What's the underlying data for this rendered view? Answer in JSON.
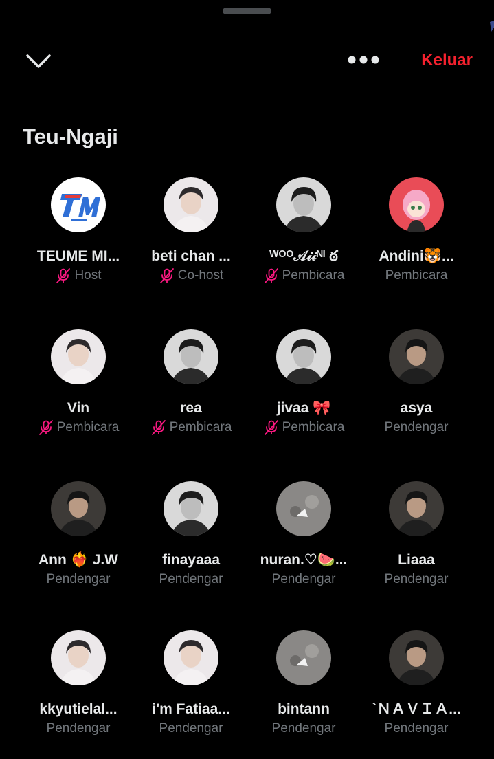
{
  "topbar": {
    "collapse_icon": "chevron-down-icon",
    "more_icon": "more-horizontal-icon",
    "leave_label": "Keluar",
    "leave_color": "#f4212e"
  },
  "space": {
    "title": "Teu-Ngaji"
  },
  "colors": {
    "background": "#000000",
    "text_primary": "#e7e9ea",
    "text_secondary": "#71767b",
    "muted_mic": "#f91880"
  },
  "participants": [
    {
      "name": "TEUME MI...",
      "role": "Host",
      "muted": true,
      "avatar": "logo-tm"
    },
    {
      "name": "beti chan ...",
      "role": "Co-host",
      "muted": true,
      "avatar": "photo-light"
    },
    {
      "name": "ᵂᴼᴼ𝒜𝒾𝒾ᴺᴵ ఠ",
      "role": "Pembicara",
      "muted": true,
      "avatar": "photo-bw"
    },
    {
      "name": "Andini🐯...",
      "role": "Pembicara",
      "muted": false,
      "avatar": "anime-pink"
    },
    {
      "name": "Vin",
      "role": "Pembicara",
      "muted": true,
      "avatar": "photo-light"
    },
    {
      "name": "rea",
      "role": "Pembicara",
      "muted": true,
      "avatar": "photo-bw"
    },
    {
      "name": "jivaa 🎀",
      "role": "Pembicara",
      "muted": true,
      "avatar": "photo-bw"
    },
    {
      "name": "asya",
      "role": "Pendengar",
      "muted": false,
      "avatar": "photo-dark"
    },
    {
      "name": "Ann ❤️‍🔥 J.W",
      "role": "Pendengar",
      "muted": false,
      "avatar": "photo-dark"
    },
    {
      "name": "finayaaa",
      "role": "Pendengar",
      "muted": false,
      "avatar": "photo-bw"
    },
    {
      "name": "nuran.♡🍉...",
      "role": "Pendengar",
      "muted": false,
      "avatar": "photo-gray"
    },
    {
      "name": "Liaaa",
      "role": "Pendengar",
      "muted": false,
      "avatar": "photo-dark"
    },
    {
      "name": "kkyutielal...",
      "role": "Pendengar",
      "muted": false,
      "avatar": "photo-light"
    },
    {
      "name": "i'm Fatiaa...",
      "role": "Pendengar",
      "muted": false,
      "avatar": "photo-light"
    },
    {
      "name": "bintann",
      "role": "Pendengar",
      "muted": false,
      "avatar": "photo-gray"
    },
    {
      "name": "`ＮＡＶＩＡ...",
      "role": "Pendengar",
      "muted": false,
      "avatar": "photo-dark"
    }
  ]
}
